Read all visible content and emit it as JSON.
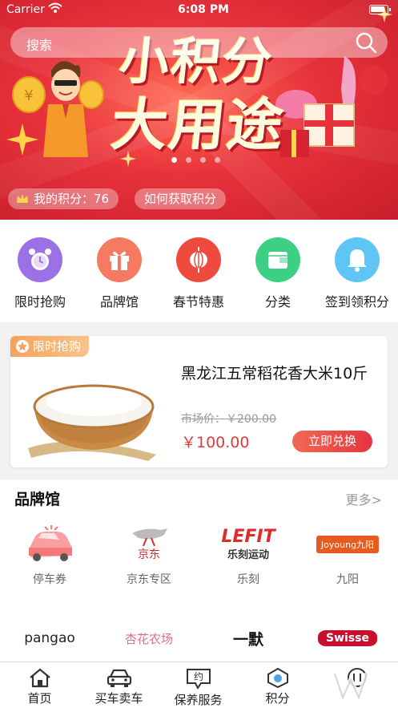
{
  "status_bar": {
    "carrier": "Carrier",
    "time": "6:08 PM"
  },
  "search": {
    "placeholder": "搜索"
  },
  "banner": {
    "headline_line1": "小积分",
    "headline_line2": "大用途",
    "slide_count": 4,
    "active_slide": 1,
    "my_points_label": "我的积分：76",
    "how_to_label": "如何获取积分",
    "colors": {
      "primary": "#e8323b",
      "accent": "#ffce4d"
    }
  },
  "quick_menu": [
    {
      "label": "限时抢购",
      "icon": "alarm-clock-icon",
      "color": "#9b72e6"
    },
    {
      "label": "品牌馆",
      "icon": "gift-icon",
      "color": "#f57a61"
    },
    {
      "label": "春节特惠",
      "icon": "lantern-icon",
      "color": "#ee4a3d"
    },
    {
      "label": "分类",
      "icon": "wallet-icon",
      "color": "#3dcf83"
    },
    {
      "label": "签到领积分",
      "icon": "bell-icon",
      "color": "#5ec5f5"
    }
  ],
  "flash_sale": {
    "tag": "限时抢购",
    "product_title": "黑龙江五常稻花香大米10斤",
    "market_price": "市场价：￥200.00",
    "price": "￥100.00",
    "buy_button": "立即兑换"
  },
  "brand_hall": {
    "title": "品牌馆",
    "more": "更多>",
    "brands": [
      {
        "name": "停车券",
        "logo": "car-icon"
      },
      {
        "name": "京东专区",
        "logo_text": "京东",
        "logo": "jd-dog-logo"
      },
      {
        "name": "乐刻",
        "logo_text": "LEFIT",
        "logo_sub": "乐刻运动"
      },
      {
        "name": "九阳",
        "logo_text": "Joyoung九阳"
      },
      {
        "logo_text": "pangao"
      },
      {
        "logo_text": "杏花农场"
      },
      {
        "logo_text": "一默"
      },
      {
        "logo_text": "Swisse"
      }
    ]
  },
  "tab_bar": [
    {
      "label": "首页",
      "icon": "home-icon"
    },
    {
      "label": "买车卖车",
      "icon": "car-front-icon"
    },
    {
      "label": "保养服务",
      "icon": "chat-bubble-icon",
      "icon_text": "约"
    },
    {
      "label": "积分",
      "icon": "points-icon"
    },
    {
      "label": "",
      "icon": "profile-icon"
    }
  ]
}
